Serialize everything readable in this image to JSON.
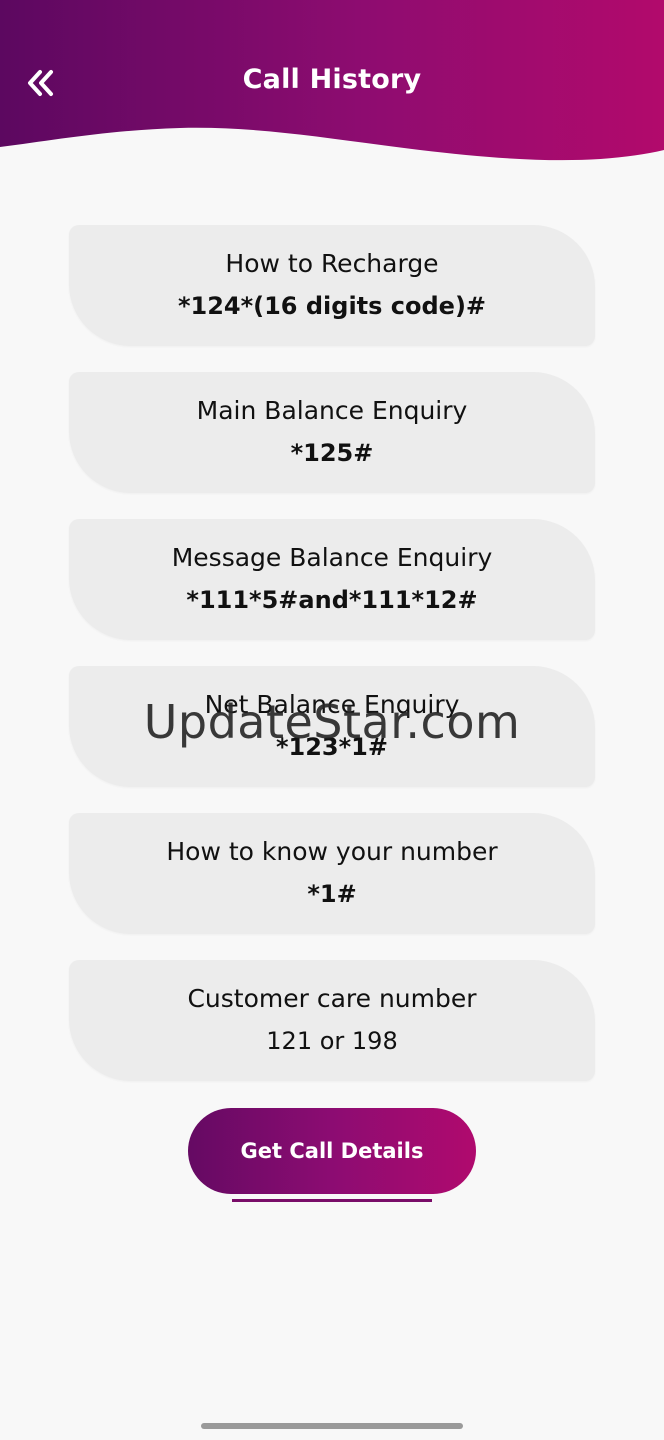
{
  "header": {
    "title": "Call History",
    "gradient_start": "#5c0860",
    "gradient_end": "#b20a6c"
  },
  "cards": [
    {
      "title": "How to Recharge",
      "code": "*124*(16 digits code)#"
    },
    {
      "title": "Main Balance Enquiry",
      "code": "*125#"
    },
    {
      "title": "Message Balance Enquiry",
      "code": "*111*5#and*111*12#"
    },
    {
      "title": "Net Balance Enquiry",
      "code": "*123*1#"
    },
    {
      "title": "How to know your number",
      "code": "*1#"
    },
    {
      "title": "Customer care number",
      "code": "121 or 198"
    }
  ],
  "watermark": "UpdateStar.com",
  "button": {
    "label": "Get Call Details"
  },
  "icons": {
    "back": "double-chevron-left-icon"
  }
}
